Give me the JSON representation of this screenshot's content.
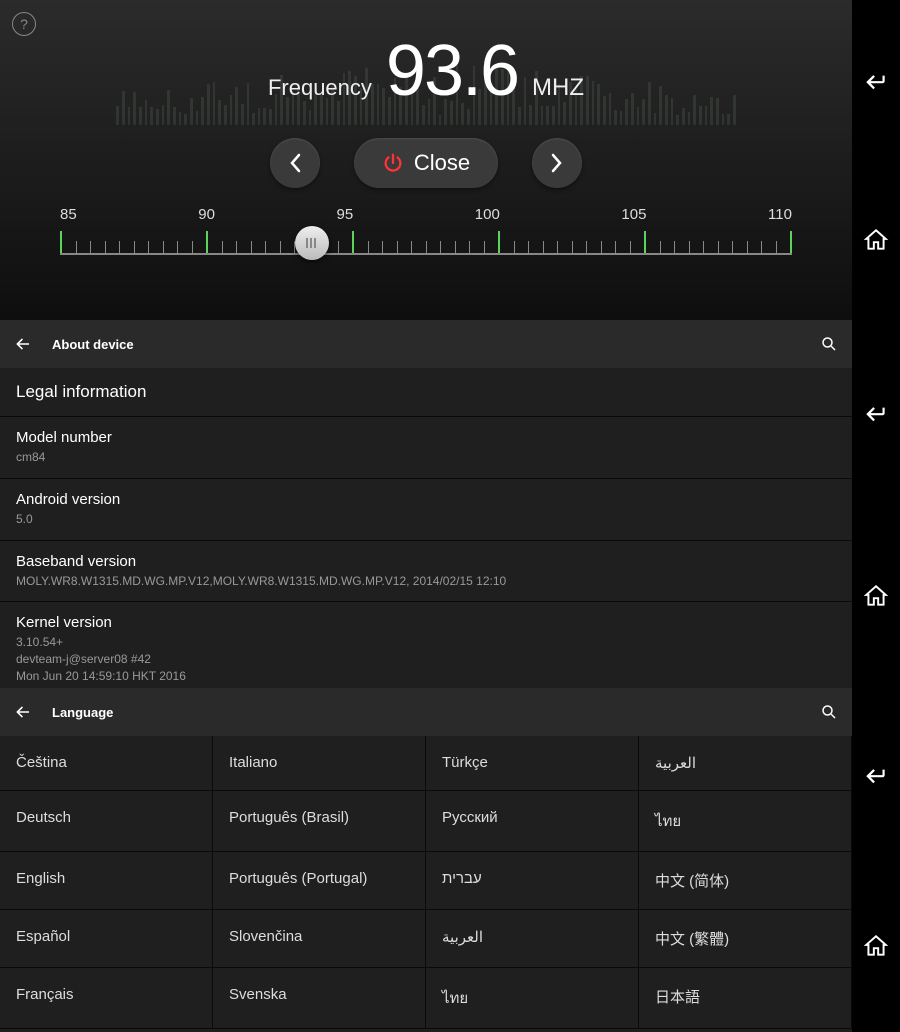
{
  "radio": {
    "freq_label": "Frequency",
    "freq_value": "93.6",
    "freq_unit": "MHZ",
    "close_label": "Close",
    "scale_labels": [
      "85",
      "90",
      "95",
      "100",
      "105",
      "110"
    ],
    "current_freq": 93.6,
    "scale_min": 85,
    "scale_max": 110
  },
  "about": {
    "header": "About device",
    "section": "Legal information",
    "rows": [
      {
        "label": "Model number",
        "value": "cm84"
      },
      {
        "label": "Android version",
        "value": "5.0"
      },
      {
        "label": "Baseband version",
        "value": "MOLY.WR8.W1315.MD.WG.MP.V12,MOLY.WR8.W1315.MD.WG.MP.V12, 2014/02/15 12:10"
      },
      {
        "label": "Kernel version",
        "value": "3.10.54+\ndevteam-j@server08 #42\nMon Jun 20 14:59:10 HKT 2016"
      }
    ]
  },
  "language": {
    "header": "Language",
    "items": [
      "Čeština",
      "Italiano",
      "Türkçe",
      "العربية",
      "Deutsch",
      "Português (Brasil)",
      "Русский",
      "ไทย",
      "English",
      "Português (Portugal)",
      "עברית",
      "中文 (简体)",
      "Español",
      "Slovenčina",
      "العربية",
      "中文 (繁體)",
      "Français",
      "Svenska",
      "ไทย",
      "日本語"
    ]
  }
}
